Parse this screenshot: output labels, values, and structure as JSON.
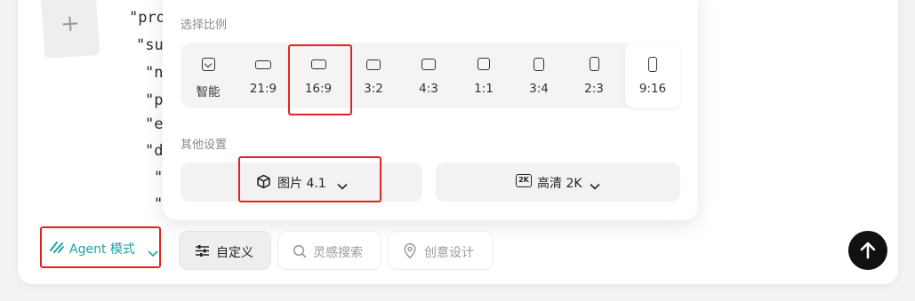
{
  "background_json": {
    "lines": [
      "\"pro",
      "\"su",
      "\"n",
      "\"p",
      "\"e",
      "\"d",
      "\"",
      "\""
    ]
  },
  "upload": {
    "icon": "plus-icon",
    "symbol": "+"
  },
  "popup": {
    "ratio_section_label": "选择比例",
    "ratios": [
      {
        "label": "智能",
        "icon": "smart-ratio-icon"
      },
      {
        "label": "21:9"
      },
      {
        "label": "16:9"
      },
      {
        "label": "3:2"
      },
      {
        "label": "4:3"
      },
      {
        "label": "1:1"
      },
      {
        "label": "3:4"
      },
      {
        "label": "2:3"
      },
      {
        "label": "9:16"
      }
    ],
    "selected_ratio": "9:16",
    "other_section_label": "其他设置",
    "model_select": {
      "icon": "cube-icon",
      "value": "图片 4.1"
    },
    "quality_select": {
      "icon": "2k-badge-icon",
      "badge": "2K",
      "value": "高清 2K"
    }
  },
  "toolbar": {
    "agent_mode": {
      "icon": "agent-icon",
      "label": "Agent 模式"
    },
    "custom": {
      "icon": "sliders-icon",
      "label": "自定义"
    },
    "inspiration_search": {
      "icon": "search-icon",
      "label": "灵感搜索"
    },
    "creative_design": {
      "icon": "location-pin-icon",
      "label": "创意设计"
    },
    "send": {
      "icon": "arrow-up-icon"
    }
  },
  "colors": {
    "accent": "#1aa3a3",
    "highlight_box": "#e02424",
    "send_button": "#111111"
  }
}
